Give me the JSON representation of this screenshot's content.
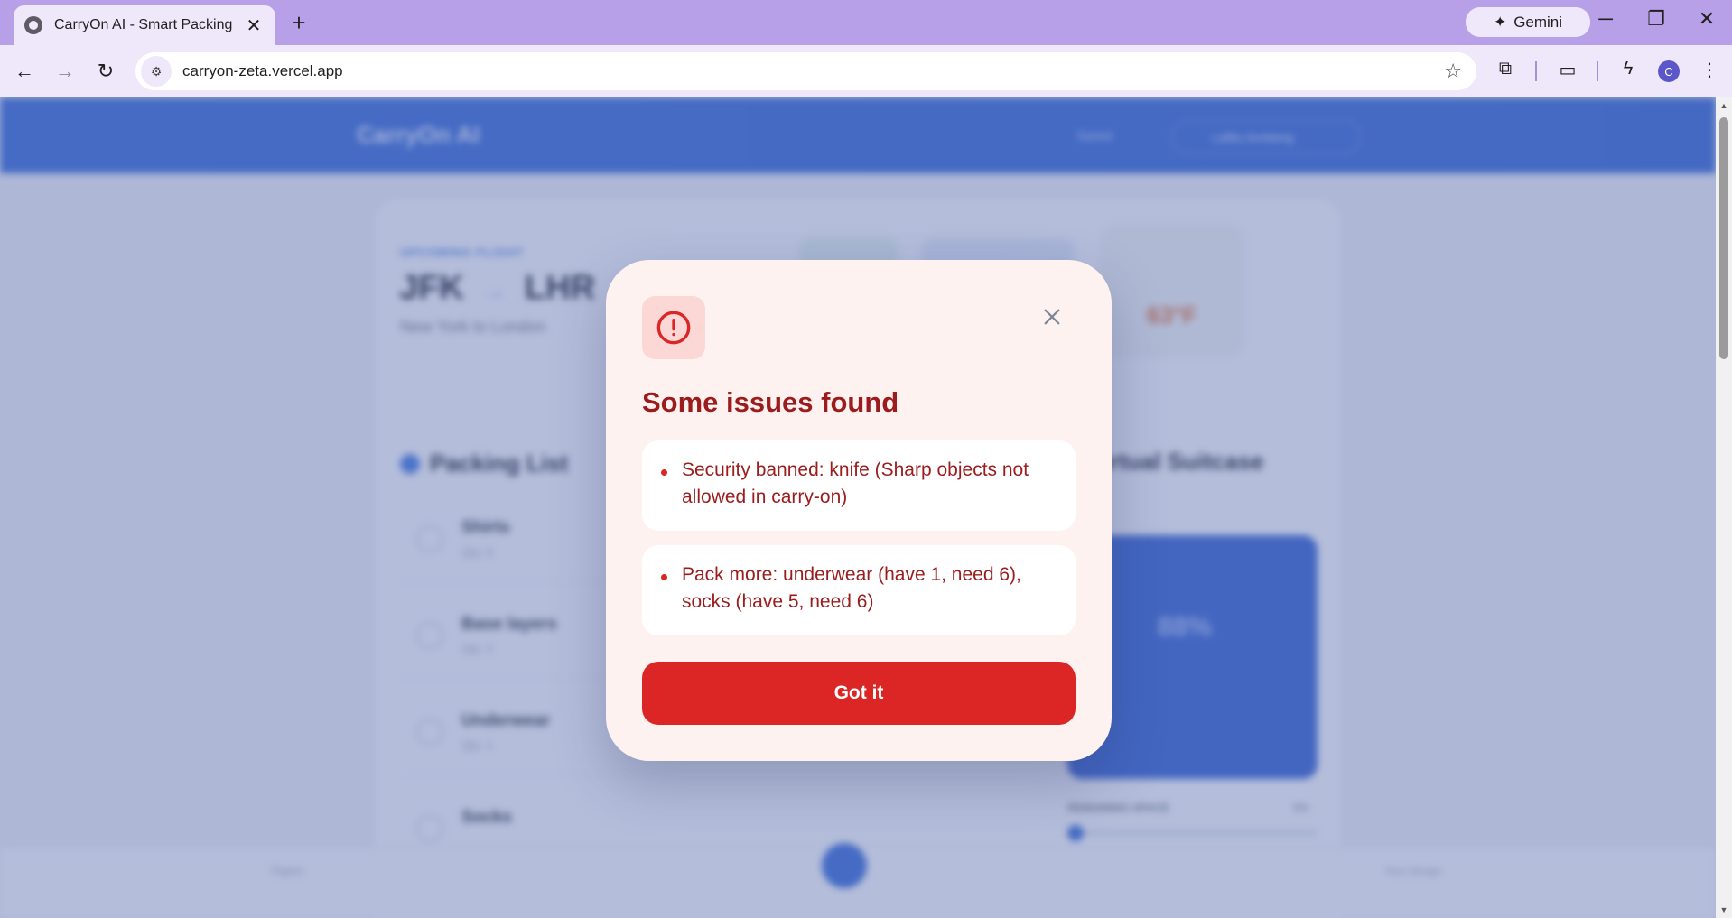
{
  "browser": {
    "tab_title": "CarryOn AI - Smart Packing",
    "url": "carryon-zeta.vercel.app",
    "gemini_label": "Gemini",
    "profile_initial": "C"
  },
  "app": {
    "logo": "CarryOn AI",
    "saved_label": "Saved",
    "user_label": "Lafitu Annberg",
    "flight": {
      "label": "UPCOMING FLIGHT",
      "origin": "JFK",
      "arrow": "→",
      "destination": "LHR",
      "subtitle": "New York to London",
      "weather_temp": "63°F"
    },
    "packing": {
      "title": "Packing List",
      "items": [
        {
          "name": "Shirts",
          "qty": "Qty: 6"
        },
        {
          "name": "Base layers",
          "qty": "Qty: 2"
        },
        {
          "name": "Underwear",
          "qty": "Qty: 1"
        },
        {
          "name": "Socks",
          "qty": ""
        }
      ]
    },
    "suitcase": {
      "title": "Virtual Suitcase",
      "percent": "88%",
      "remaining_label": "REMAINING SPACE",
      "remaining_value": "0%"
    },
    "bottom_nav": {
      "flights": "Flights",
      "your_design": "Your design"
    }
  },
  "modal": {
    "title": "Some issues found",
    "issues": [
      "Security banned: knife (Sharp objects not allowed in carry-on)",
      "Pack more: underwear (have 1, need 6), socks (have 5, need 6)"
    ],
    "confirm_label": "Got it",
    "accent": "#dc2626",
    "text_color": "#9b1c1c"
  }
}
